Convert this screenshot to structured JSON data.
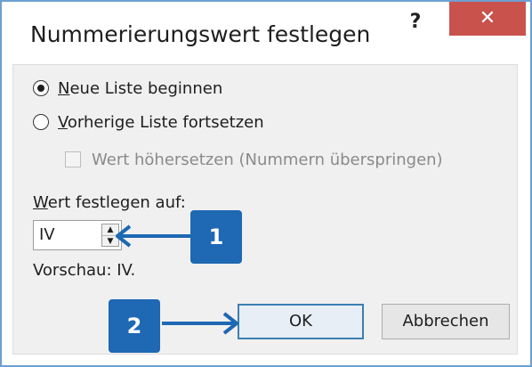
{
  "dialog": {
    "title": "Nummerierungswert festlegen",
    "help_label": "?",
    "close_label": "✕"
  },
  "options": {
    "new_list_rest": "eue Liste beginnen",
    "new_list_underline": "N",
    "continue_list_rest": "orherige Liste fortsetzen",
    "continue_list_underline": "V",
    "advance_value": "Wert höhersetzen (Nummern überspringen)"
  },
  "set_value": {
    "label_underline": "W",
    "label_rest": "ert festlegen auf:",
    "value": "IV"
  },
  "preview": "Vorschau: IV.",
  "buttons": {
    "ok": "OK",
    "cancel": "Abbrechen"
  },
  "callouts": {
    "one": "1",
    "two": "2"
  },
  "colors": {
    "accent": "#1e68b4",
    "close": "#c9524c",
    "frame": "#6d9fd2"
  }
}
